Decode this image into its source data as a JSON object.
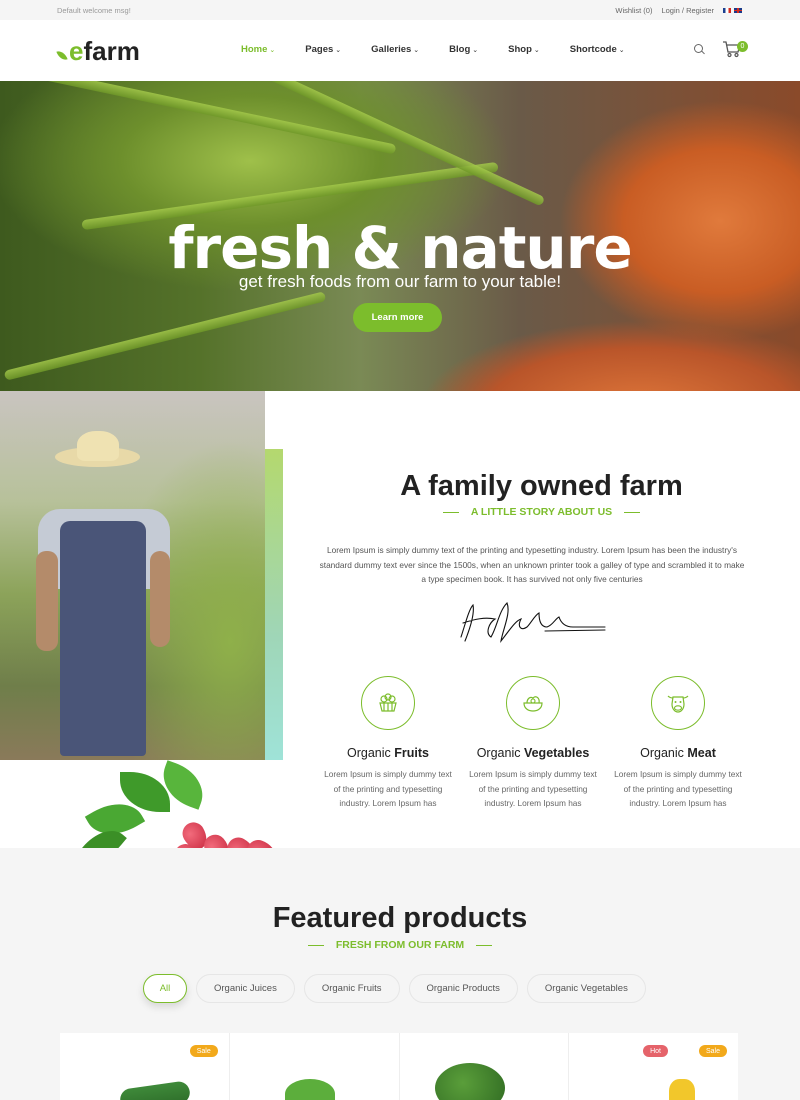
{
  "topbar": {
    "welcome": "Default welcome msg!",
    "wishlist": "Wishlist (0)",
    "login": "Login / Register"
  },
  "header": {
    "logo_e": "e",
    "logo_rest": "farm",
    "nav": [
      {
        "label": "Home",
        "active": true
      },
      {
        "label": "Pages"
      },
      {
        "label": "Galleries"
      },
      {
        "label": "Blog"
      },
      {
        "label": "Shop"
      },
      {
        "label": "Shortcode"
      }
    ],
    "cart_count": "0"
  },
  "hero": {
    "title": "fresh & nature",
    "subtitle": "get fresh foods from our farm to your table!",
    "button": "Learn more"
  },
  "about": {
    "title": "A family owned farm",
    "subtitle": "A LITTLE STORY ABOUT US",
    "text": "Lorem Ipsum is simply dummy text of the printing and typesetting industry. Lorem Ipsum has been the industry's standard dummy text ever since the 1500s, when an unknown printer took a galley of type and scrambled it to make a type specimen book. It has survived not only five centuries",
    "features": [
      {
        "prefix": "Organic ",
        "name": "Fruits",
        "icon": "fruit-basket-icon",
        "text": "Lorem Ipsum is simply dummy text of the printing and typesetting industry. Lorem Ipsum has"
      },
      {
        "prefix": "Organic ",
        "name": "Vegetables",
        "icon": "vegetables-bowl-icon",
        "text": "Lorem Ipsum is simply dummy text of the printing and typesetting industry. Lorem Ipsum has"
      },
      {
        "prefix": "Organic ",
        "name": "Meat",
        "icon": "cow-head-icon",
        "text": "Lorem Ipsum is simply dummy text of the printing and typesetting industry. Lorem Ipsum has"
      }
    ]
  },
  "featured": {
    "title": "Featured products",
    "subtitle": "FRESH FROM OUR FARM",
    "tabs": [
      "All",
      "Organic Juices",
      "Organic Fruits",
      "Organic Products",
      "Organic Vegetables"
    ],
    "badges": {
      "sale": "Sale",
      "hot": "Hot"
    }
  },
  "colors": {
    "accent": "#7cbd2c",
    "sale": "#f2a91b",
    "hot": "#e5636a"
  }
}
